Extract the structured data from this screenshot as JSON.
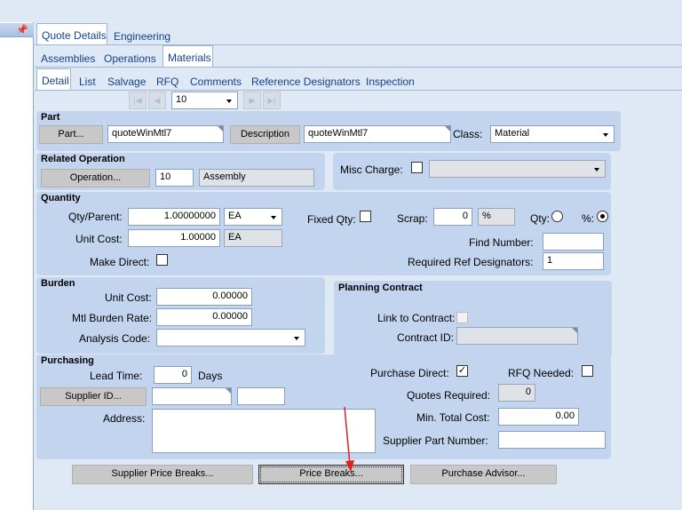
{
  "tabs": {
    "level1": [
      "Quote Details",
      "Engineering"
    ],
    "level2": [
      "Assemblies",
      "Operations",
      "Materials"
    ],
    "level3": [
      "Detail",
      "List",
      "Salvage",
      "RFQ",
      "Comments",
      "Reference Designators",
      "Inspection"
    ]
  },
  "navigator": {
    "value": "10"
  },
  "part": {
    "title": "Part",
    "part_button": "Part...",
    "part_value": "quoteWinMtl7",
    "description_button": "Description",
    "description_value": "quoteWinMtl7",
    "class_label": "Class:",
    "class_value": "Material"
  },
  "related_operation": {
    "title": "Related Operation",
    "operation_button": "Operation...",
    "operation_value": "10",
    "operation_desc": "Assembly"
  },
  "misc_charge": {
    "label": "Misc Charge:"
  },
  "quantity": {
    "title": "Quantity",
    "qty_parent_label": "Qty/Parent:",
    "qty_parent_value": "1.00000000",
    "qty_uom": "EA",
    "fixed_qty_label": "Fixed Qty:",
    "scrap_label": "Scrap:",
    "scrap_value": "0",
    "scrap_unit": "%",
    "qty_radio_label": "Qty:",
    "pct_radio_label": "%:",
    "unit_cost_label": "Unit Cost:",
    "unit_cost_value": "1.00000",
    "unit_cost_uom": "EA",
    "find_number_label": "Find Number:",
    "make_direct_label": "Make Direct:",
    "req_ref_label": "Required Ref Designators:",
    "req_ref_value": "1"
  },
  "burden": {
    "title": "Burden",
    "unit_cost_label": "Unit Cost:",
    "unit_cost_value": "0.00000",
    "rate_label": "Mtl  Burden Rate:",
    "rate_value": "0.00000",
    "analysis_label": "Analysis Code:"
  },
  "planning": {
    "title": "Planning Contract",
    "link_label": "Link to Contract:",
    "contract_label": "Contract ID:"
  },
  "purchasing": {
    "title": "Purchasing",
    "lead_time_label": "Lead Time:",
    "lead_time_value": "0",
    "days_label": "Days",
    "supplier_button": "Supplier ID...",
    "address_label": "Address:",
    "purchase_direct_label": "Purchase Direct:",
    "purchase_direct_mark": "✓",
    "rfq_needed_label": "RFQ Needed:",
    "quotes_required_label": "Quotes Required:",
    "quotes_required_value": "0",
    "min_total_label": "Min. Total Cost:",
    "min_total_value": "0.00",
    "supplier_part_label": "Supplier Part Number:"
  },
  "buttons": {
    "supplier_price_breaks": "Supplier Price Breaks...",
    "price_breaks": "Price Breaks...",
    "purchase_advisor": "Purchase Advisor..."
  },
  "colors": {
    "accent": "#15428b",
    "group": "#c3d5ee",
    "arrow": "#e02020"
  }
}
